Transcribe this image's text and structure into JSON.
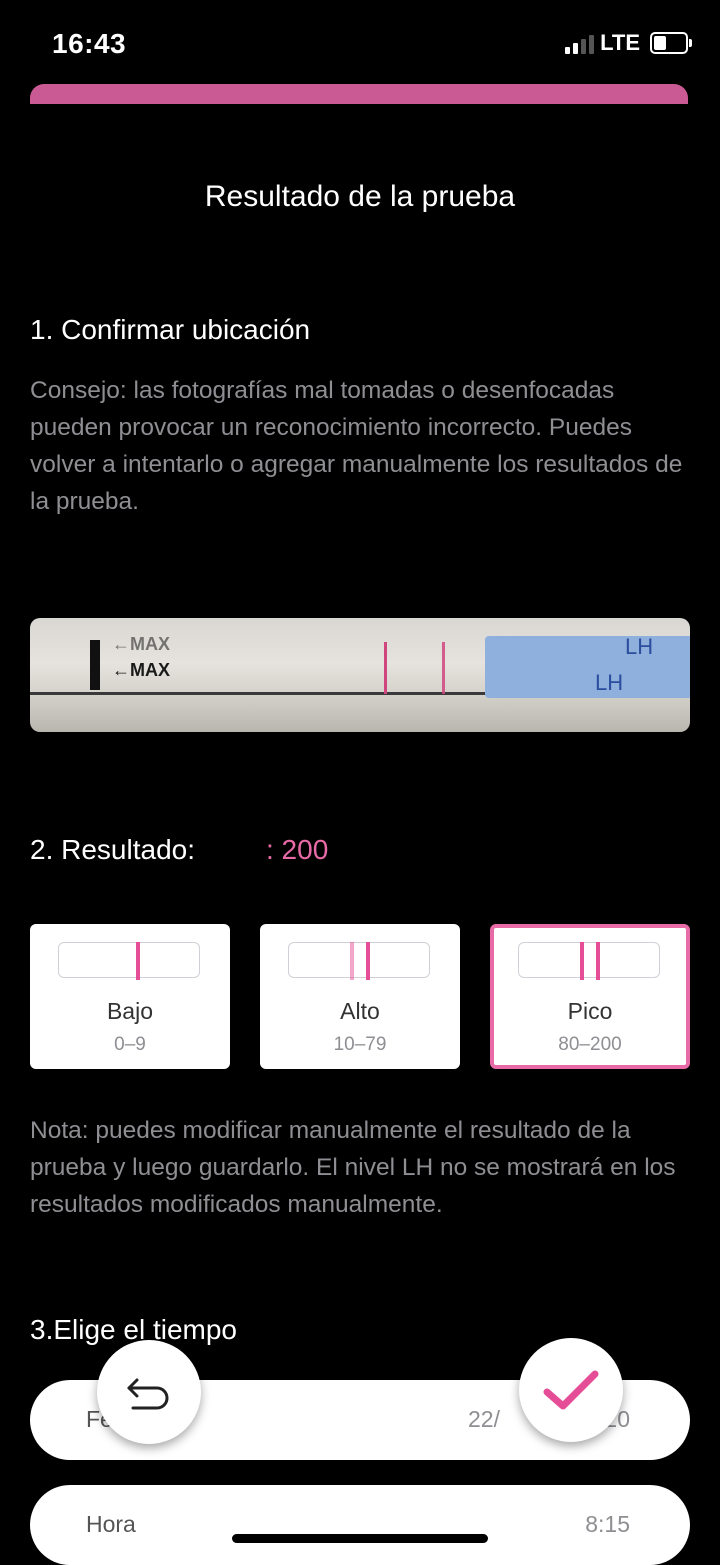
{
  "status_bar": {
    "time": "16:43",
    "network": "LTE"
  },
  "page_title": "Resultado de la prueba",
  "section1": {
    "heading": "1. Confirmar ubicación",
    "tip": "Consejo: las fotografías mal tomadas o desenfocadas pueden provocar un reconocimiento incorrecto. Puedes volver a intentarlo o agregar manualmente los resultados de la prueba."
  },
  "test_strip": {
    "mark1": "←MAX",
    "mark2": "←MAX",
    "brand": "LH"
  },
  "section2": {
    "heading": "2. Resultado:",
    "value": ": 200",
    "options": [
      {
        "label": "Bajo",
        "range": "0–9"
      },
      {
        "label": "Alto",
        "range": "10–79"
      },
      {
        "label": "Pico",
        "range": "80–200"
      }
    ],
    "selected": "Pico",
    "note": "Nota: puedes modificar manualmente el resultado de la prueba y luego guardarlo. El nivel LH no se mostrará en los resultados modificados manualmente."
  },
  "section3": {
    "heading": "3.Elige el tiempo",
    "date_label": "Fe",
    "date_value": "22/",
    "date_value_tail": "20",
    "time_label": "Hora",
    "time_value": "8:15"
  },
  "colors": {
    "accent": "#e86aa6",
    "bar": "#c95a93"
  },
  "icons": {
    "back": "undo-arrow-icon",
    "confirm": "checkmark-icon"
  }
}
